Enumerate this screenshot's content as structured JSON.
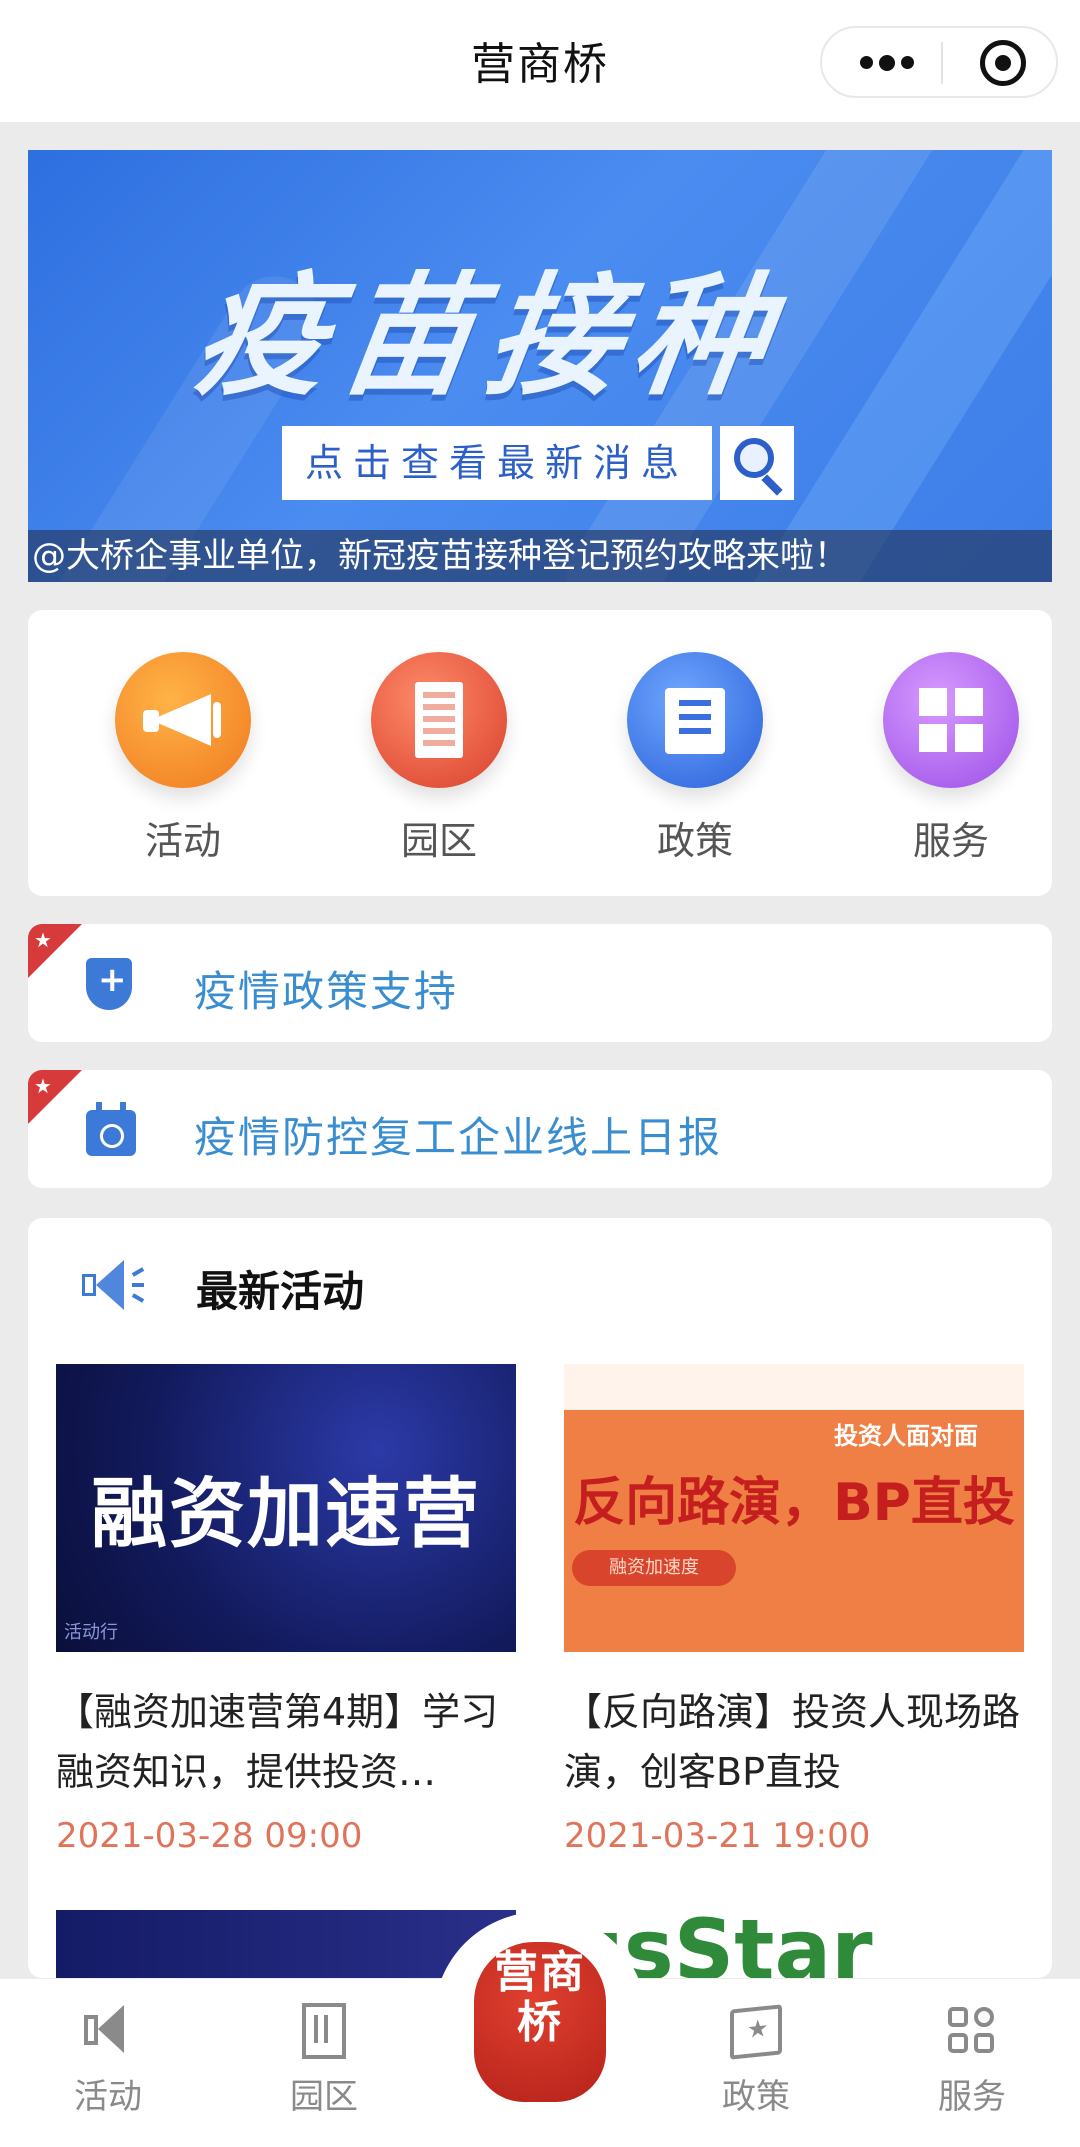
{
  "titlebar": {
    "title": "营商桥"
  },
  "banner": {
    "headline": "疫苗接种",
    "search_text": "点击查看最新消息",
    "caption": "@大桥企事业单位，新冠疫苗接种登记预约攻略来啦！"
  },
  "quick_menu": [
    {
      "label": "活动",
      "icon": "megaphone-icon",
      "color": "#f07a1f"
    },
    {
      "label": "园区",
      "icon": "building-icon",
      "color": "#d8402c"
    },
    {
      "label": "政策",
      "icon": "document-icon",
      "color": "#2a5fd8"
    },
    {
      "label": "服务",
      "icon": "grid-icon",
      "color": "#9b4ee6"
    }
  ],
  "links": [
    {
      "text": "疫情政策支持",
      "icon": "shield-plus-icon"
    },
    {
      "text": "疫情防控复工企业线上日报",
      "icon": "calendar-icon"
    }
  ],
  "activities": {
    "heading": "最新活动",
    "items": [
      {
        "thumb_text": "融资加速营",
        "thumb_tag": "活动行",
        "title": "【融资加速营第4期】学习融资知识，提供投资…",
        "date": "2021-03-28 09:00"
      },
      {
        "thumb_text": "反向路演，BP直投",
        "thumb_corner": "投资人面对面",
        "thumb_pill": "融资加速度",
        "title": "【反向路演】投资人现场路演，创客BP直投",
        "date": "2021-03-21 19:00"
      }
    ],
    "peek_text": "usStar"
  },
  "tabbar": {
    "tabs": [
      {
        "label": "活动",
        "icon": "megaphone-icon"
      },
      {
        "label": "园区",
        "icon": "building-icon"
      },
      {
        "label": "政策",
        "icon": "policy-book-icon"
      },
      {
        "label": "服务",
        "icon": "apps-grid-icon"
      }
    ],
    "center_seal": "营商桥"
  },
  "colors": {
    "accent_blue": "#3a8ed0",
    "date_orange": "#e0745a",
    "corner_red": "#d73a3a"
  }
}
